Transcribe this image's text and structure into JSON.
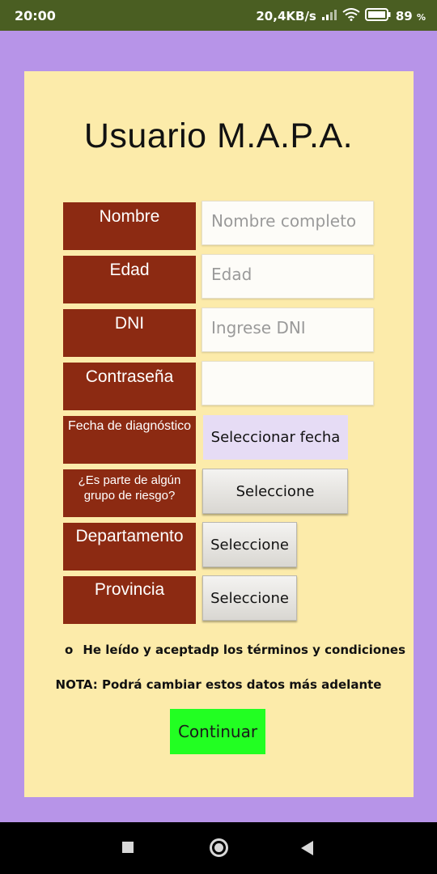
{
  "status_bar": {
    "time": "20:00",
    "network_speed": "20,4KB/s",
    "battery": "89",
    "battery_unit": "%"
  },
  "title": "Usuario M.A.P.A.",
  "fields": {
    "nombre": {
      "label": "Nombre",
      "placeholder": "Nombre completo"
    },
    "edad": {
      "label": "Edad",
      "placeholder": "Edad"
    },
    "dni": {
      "label": "DNI",
      "placeholder": "Ingrese DNI"
    },
    "contrasena": {
      "label": "Contraseña",
      "placeholder": ""
    },
    "fecha": {
      "label": "Fecha de diagnóstico",
      "button": "Seleccionar fecha"
    },
    "grupo_riesgo": {
      "label_line1": "¿Es parte de algún",
      "label_line2": "grupo de riesgo?",
      "button": "Seleccione"
    },
    "departamento": {
      "label": "Departamento",
      "button": "Seleccione"
    },
    "provincia": {
      "label": "Provincia",
      "button": "Seleccione"
    }
  },
  "terms": {
    "radio": "o",
    "text": "He leído y aceptadp los términos y condiciones"
  },
  "nota": "NOTA: Podrá cambiar estos datos más adelante",
  "continue_button": "Continuar",
  "colors": {
    "background": "#b794e8",
    "card": "#fcebaa",
    "label_bg": "#8c2a12",
    "continue_bg": "#22ff22",
    "status_bar": "#4a5e22"
  }
}
